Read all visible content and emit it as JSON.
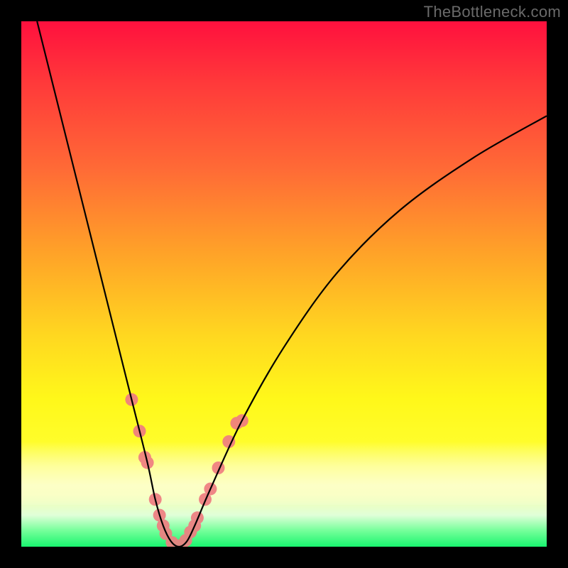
{
  "watermark": "TheBottleneck.com",
  "chart_data": {
    "type": "line",
    "title": "",
    "xlabel": "",
    "ylabel": "",
    "xlim": [
      0,
      100
    ],
    "ylim": [
      0,
      100
    ],
    "grid": false,
    "legend": false,
    "series": [
      {
        "name": "bottleneck-curve",
        "x": [
          3,
          6,
          9,
          12,
          15,
          18,
          21,
          24,
          25.5,
          27,
          28.5,
          30,
          31.5,
          33,
          36,
          42,
          50,
          60,
          72,
          86,
          100
        ],
        "y": [
          100,
          88,
          76,
          64,
          52,
          40,
          28,
          16,
          9,
          4,
          1,
          0,
          1,
          4,
          11,
          24,
          38,
          52,
          64,
          74,
          82
        ]
      }
    ],
    "annotations": {
      "pink_dot_band_y_range": [
        3,
        32
      ],
      "curve_minimum_x": 30,
      "description": "V-shaped curve on a vertical hot-to-cool rainbow gradient, with soft pink dots along the lower portion of both branches"
    },
    "colors": {
      "gradient_top": "#ff103e",
      "gradient_mid": "#ffd820",
      "gradient_bottom": "#19f56f",
      "curve": "#000000",
      "dots": "#ef7d81",
      "watermark": "#6a6a6a"
    }
  }
}
